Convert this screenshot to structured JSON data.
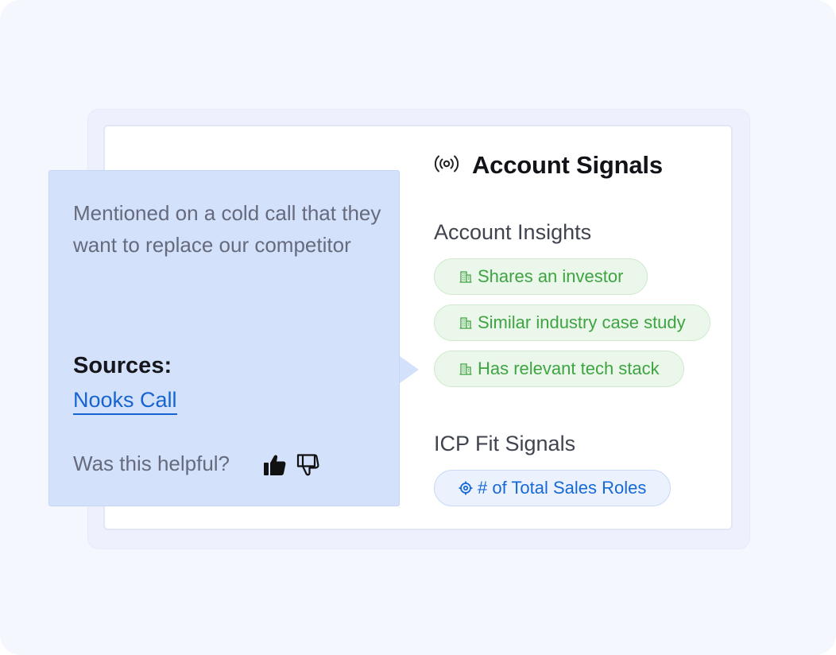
{
  "signals": {
    "title": "Account Signals",
    "icon": "broadcast-icon"
  },
  "insights": {
    "label": "Account Insights",
    "icon": "building-icon",
    "items": [
      "Shares an investor",
      "Similar industry case study",
      "Has relevant tech stack"
    ]
  },
  "icp": {
    "label": "ICP Fit Signals",
    "icon": "target-icon",
    "items": [
      "# of Total Sales Roles"
    ]
  },
  "popover": {
    "text": "Mentioned on a cold call that they want to replace our competitor",
    "sources_label": "Sources:",
    "source_link": "Nooks Call",
    "helpful_prompt": "Was this helpful?",
    "thumbs_up_icon": "thumbs-up-icon",
    "thumbs_down_icon": "thumbs-down-icon"
  },
  "colors": {
    "background": "#f5f7ff",
    "popover": "#d4e1fb",
    "green_pill_text": "#3ea442",
    "blue_pill_text": "#1669d6",
    "link": "#1664cf"
  }
}
